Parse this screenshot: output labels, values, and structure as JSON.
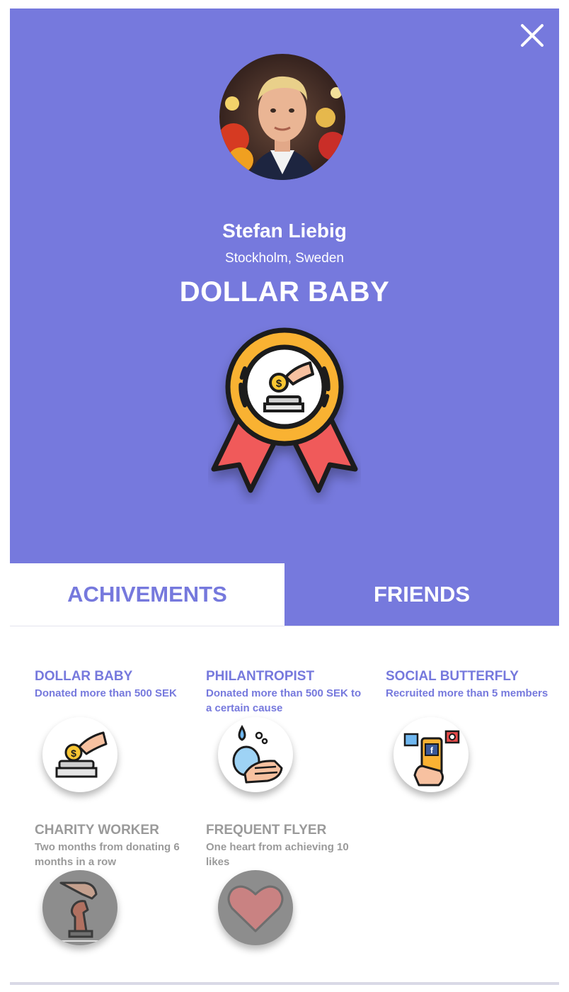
{
  "profile": {
    "name": "Stefan Liebig",
    "location": "Stockholm, Sweden",
    "current_badge": "DOLLAR BABY"
  },
  "tabs": [
    {
      "label": "ACHIVEMENTS",
      "active": true
    },
    {
      "label": "FRIENDS",
      "active": false
    }
  ],
  "achievements": [
    {
      "title": "DOLLAR BABY",
      "description": "Donated more than 500 SEK",
      "earned": true,
      "icon": "coin-donation-icon"
    },
    {
      "title": "PHILANTROPIST",
      "description": "Donated more than 500 SEK to a certain cause",
      "earned": true,
      "icon": "washing-hands-icon"
    },
    {
      "title": "SOCIAL BUTTERFLY",
      "description": "Recruited more than 5 members",
      "earned": true,
      "icon": "social-media-phone-icon"
    },
    {
      "title": "CHARITY WORKER",
      "description": "Two months from donating 6 months in a row",
      "earned": false,
      "icon": "chess-knight-hand-icon"
    },
    {
      "title": "FREQUENT FLYER",
      "description": "One heart from achieving 10 likes",
      "earned": false,
      "icon": "heart-icon"
    }
  ],
  "colors": {
    "accent": "#7679dd",
    "locked_text": "#9a9a9a",
    "locked_icon_bg": "#8d8d8d",
    "medal_ring": "#f9b233",
    "ribbon": "#f05a5a"
  }
}
